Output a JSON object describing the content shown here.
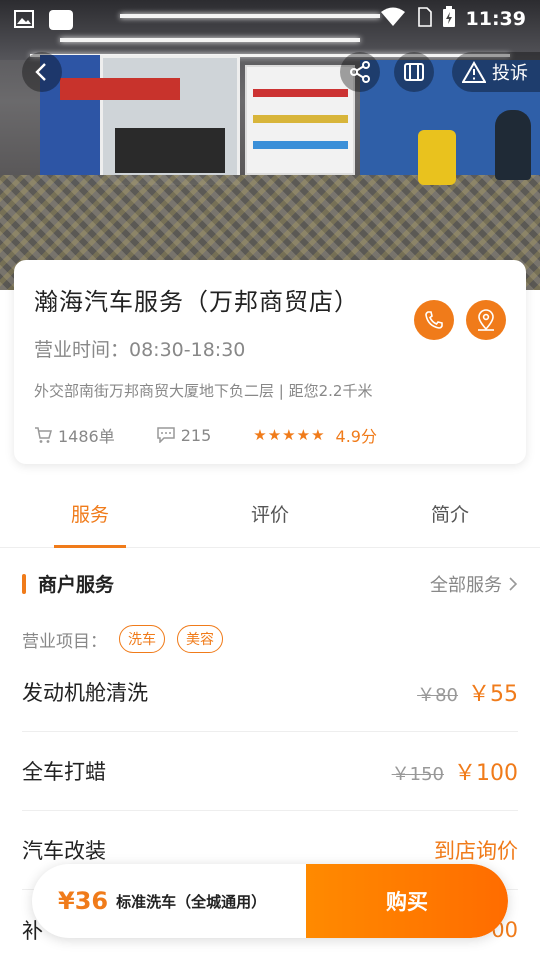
{
  "status_bar": {
    "time": "11:39"
  },
  "nav": {
    "report_label": "投诉"
  },
  "shop": {
    "name": "瀚海汽车服务（万邦商贸店）",
    "hours": "营业时间：08:30-18:30",
    "address": "外交部南街万邦商贸大厦地下负二层 | 距您2.2千米",
    "orders": "1486单",
    "comments": "215",
    "rating": "4.9分",
    "stars": 5
  },
  "tabs": [
    {
      "label": "服务",
      "active": true
    },
    {
      "label": "评价",
      "active": false
    },
    {
      "label": "简介",
      "active": false
    }
  ],
  "services_section": {
    "title": "商户服务",
    "more_label": "全部服务",
    "business_label": "营业项目：",
    "tags": [
      "洗车",
      "美容"
    ],
    "items": [
      {
        "name": "发动机舱清洗",
        "old_price": "￥80",
        "price": "￥55"
      },
      {
        "name": "全车打蜡",
        "old_price": "￥150",
        "price": "￥100"
      },
      {
        "name": "汽车改装",
        "ask_label": "到店询价"
      },
      {
        "name": "补",
        "price": "00"
      }
    ]
  },
  "buy_bar": {
    "price": "¥36",
    "description": "标准洗车（全城通用）",
    "button_label": "购买"
  },
  "colors": {
    "accent": "#f07b1a"
  }
}
